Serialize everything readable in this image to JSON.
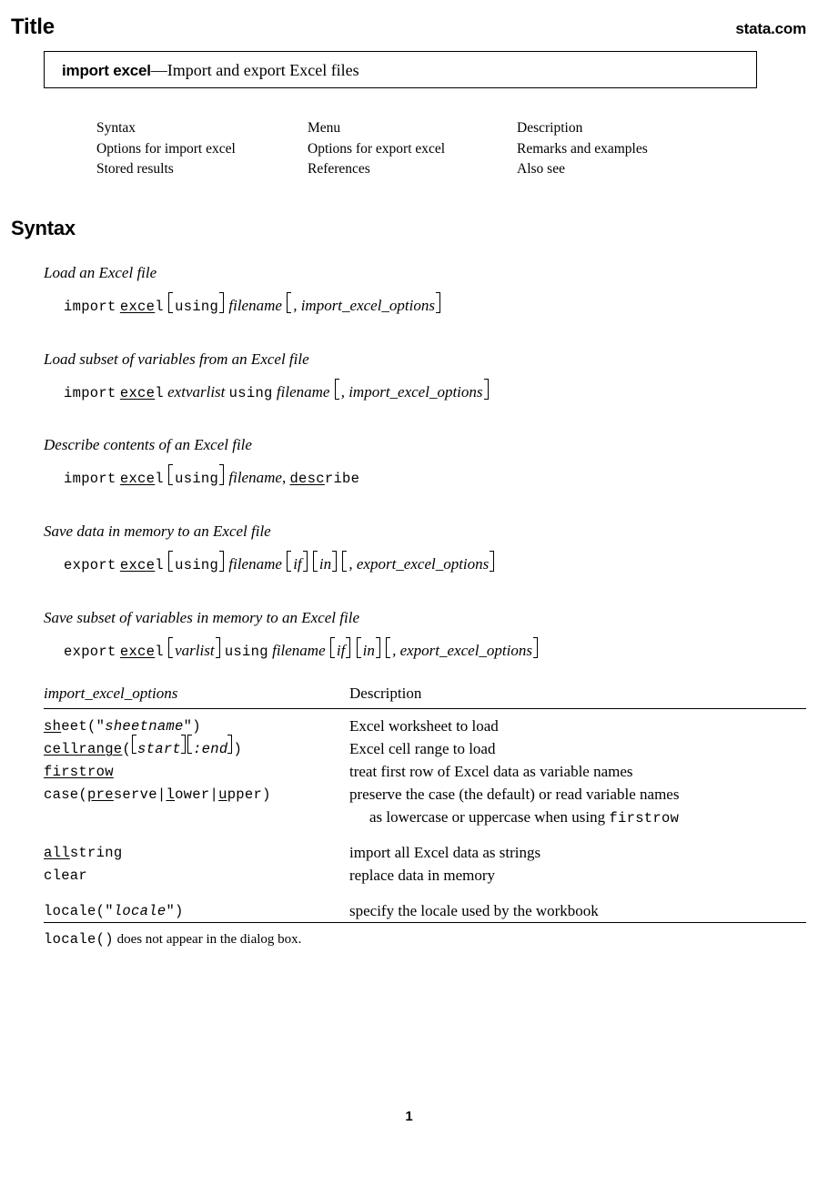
{
  "header": {
    "title": "Title",
    "site": "stata.com"
  },
  "title_box": {
    "command": "import excel",
    "dash": "—",
    "description": "Import and export Excel files"
  },
  "nav": {
    "rows": [
      [
        "Syntax",
        "Menu",
        "Description"
      ],
      [
        "Options for import excel",
        "Options for export excel",
        "Remarks and examples"
      ],
      [
        "Stored results",
        "References",
        "Also see"
      ]
    ]
  },
  "sections": {
    "syntax": "Syntax"
  },
  "syntax_blocks": [
    {
      "label": "Load an Excel file",
      "tokens": [
        {
          "t": "import",
          "k": "mono"
        },
        {
          "t": " ",
          "k": "sp"
        },
        {
          "t": "exce",
          "k": "mono-ul"
        },
        {
          "t": "l",
          "k": "mono"
        },
        {
          "t": "using",
          "k": "bracket-mono"
        },
        {
          "t": "filename",
          "k": "italic"
        },
        {
          "t": ", import_excel_options",
          "k": "bracket-italic-comma"
        }
      ]
    },
    {
      "label": "Load subset of variables from an Excel file",
      "tokens": [
        {
          "t": "import",
          "k": "mono"
        },
        {
          "t": " ",
          "k": "sp"
        },
        {
          "t": "exce",
          "k": "mono-ul"
        },
        {
          "t": "l",
          "k": "mono"
        },
        {
          "t": "extvarlist",
          "k": "italic"
        },
        {
          "t": "using",
          "k": "mono"
        },
        {
          "t": "filename",
          "k": "italic"
        },
        {
          "t": ", import_excel_options",
          "k": "bracket-italic-comma"
        }
      ]
    },
    {
      "label": "Describe contents of an Excel file",
      "tokens": [
        {
          "t": "import",
          "k": "mono"
        },
        {
          "t": " ",
          "k": "sp"
        },
        {
          "t": "exce",
          "k": "mono-ul"
        },
        {
          "t": "l",
          "k": "mono"
        },
        {
          "t": "using",
          "k": "bracket-mono"
        },
        {
          "t": "filename",
          "k": "italic"
        },
        {
          "t": ",",
          "k": "plain"
        },
        {
          "t": "desc",
          "k": "mono-ul"
        },
        {
          "t": "ribe",
          "k": "mono"
        }
      ]
    },
    {
      "label": "Save data in memory to an Excel file",
      "tokens": [
        {
          "t": "export",
          "k": "mono"
        },
        {
          "t": " ",
          "k": "sp"
        },
        {
          "t": "exce",
          "k": "mono-ul"
        },
        {
          "t": "l",
          "k": "mono"
        },
        {
          "t": "using",
          "k": "bracket-mono"
        },
        {
          "t": "filename",
          "k": "italic"
        },
        {
          "t": "if",
          "k": "bracket-italic"
        },
        {
          "t": "in",
          "k": "bracket-italic"
        },
        {
          "t": ", export_excel_options",
          "k": "bracket-italic-comma"
        }
      ]
    },
    {
      "label": "Save subset of variables in memory to an Excel file",
      "tokens": [
        {
          "t": "export",
          "k": "mono"
        },
        {
          "t": " ",
          "k": "sp"
        },
        {
          "t": "exce",
          "k": "mono-ul"
        },
        {
          "t": "l",
          "k": "mono"
        },
        {
          "t": "varlist",
          "k": "bracket-italic"
        },
        {
          "t": "using",
          "k": "mono"
        },
        {
          "t": "filename",
          "k": "italic"
        },
        {
          "t": "if",
          "k": "bracket-italic"
        },
        {
          "t": "in",
          "k": "bracket-italic"
        },
        {
          "t": ", export_excel_options",
          "k": "bracket-italic-comma"
        }
      ]
    }
  ],
  "syntax_labels": {
    "load_file": "Load an Excel file",
    "load_subset": "Load subset of variables from an Excel file",
    "describe": "Describe contents of an Excel file",
    "save_file": "Save data in memory to an Excel file",
    "save_subset": "Save subset of variables in memory to an Excel file"
  },
  "options_table": {
    "col1_header": "import_excel_options",
    "col2_header": "Description",
    "rows": [
      {
        "option": "sheet(\"sheetname\")",
        "abbrev": "sh",
        "description": "Excel worksheet to load"
      },
      {
        "option": "cellrange([start][:end])",
        "abbrev": "cellrange",
        "description": "Excel cell range to load"
      },
      {
        "option": "firstrow",
        "abbrev": "firstrow",
        "description": "treat first row of Excel data as variable names"
      },
      {
        "option": "case(preserve|lower|upper)",
        "abbrev": "pre / l / u",
        "description": "preserve the case (the default) or read variable names",
        "description_cont": "as lowercase or uppercase when using firstrow"
      },
      {
        "option": "allstring",
        "abbrev": "all",
        "description": "import all Excel data as strings"
      },
      {
        "option": "clear",
        "abbrev": "",
        "description": "replace data in memory"
      },
      {
        "option": "locale(\"locale\")",
        "abbrev": "",
        "description": "specify the locale used by the workbook"
      }
    ]
  },
  "option_parts": {
    "sheet_a": "sh",
    "sheet_b": "eet",
    "sheet_arg": "sheetname",
    "cellrange_ul": "cellrange",
    "cellrange_start": "start",
    "cellrange_end": ":end",
    "firstrow_a": "firstrow",
    "case_lead": "case(",
    "case_pre_ul": "pre",
    "case_pre_rest": "serve",
    "case_l_ul": "l",
    "case_l_rest": "ower",
    "case_u_ul": "u",
    "case_u_rest": "pper",
    "case_close": ")",
    "allstring_ul": "all",
    "allstring_rest": "string",
    "clear": "clear",
    "locale_lead": "locale(",
    "locale_arg": "locale",
    "locale_close": ")",
    "firstrow_in_desc": "firstrow"
  },
  "descriptions": {
    "d1": "Excel worksheet to load",
    "d2": "Excel cell range to load",
    "d3": "treat first row of Excel data as variable names",
    "d4a": "preserve the case (the default) or read variable names",
    "d4b_pre": "as lowercase or uppercase when using",
    "d5": "import all Excel data as strings",
    "d6": "replace data in memory",
    "d7": "specify the locale used by the workbook"
  },
  "footnote": {
    "code": "locale()",
    "text": " does not appear in the dialog box."
  },
  "page": {
    "number": "1"
  }
}
